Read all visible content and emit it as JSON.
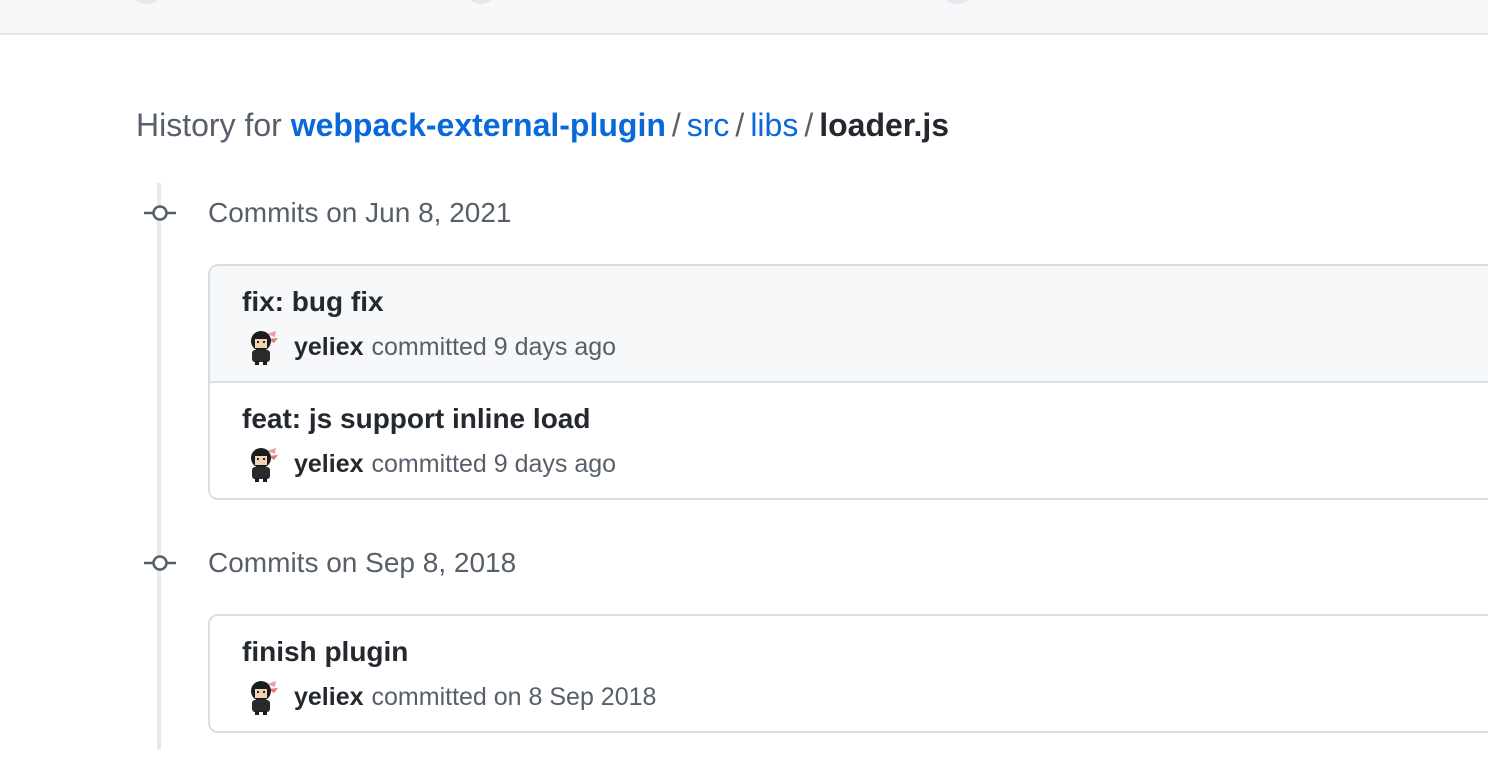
{
  "header": {
    "prefix": "History for",
    "repo": "webpack-external-plugin",
    "separator": "/",
    "path_segments": [
      "src",
      "libs"
    ],
    "file": "loader.js"
  },
  "groups": [
    {
      "title": "Commits on Jun 8, 2021",
      "commits": [
        {
          "message": "fix: bug fix",
          "author": "yeliex",
          "when": "committed 9 days ago"
        },
        {
          "message": "feat: js support inline load",
          "author": "yeliex",
          "when": "committed 9 days ago"
        }
      ]
    },
    {
      "title": "Commits on Sep 8, 2018",
      "commits": [
        {
          "message": "finish plugin",
          "author": "yeliex",
          "when": "committed on 8 Sep 2018"
        }
      ]
    }
  ],
  "colors": {
    "link": "#0969da",
    "muted_text": "#57606a",
    "primary_text": "#24292f",
    "border": "#d8dee4",
    "hover_row_bg": "#f6f8fa"
  },
  "icons": {
    "commit_node": "git-commit-icon",
    "avatar": "user-avatar"
  }
}
